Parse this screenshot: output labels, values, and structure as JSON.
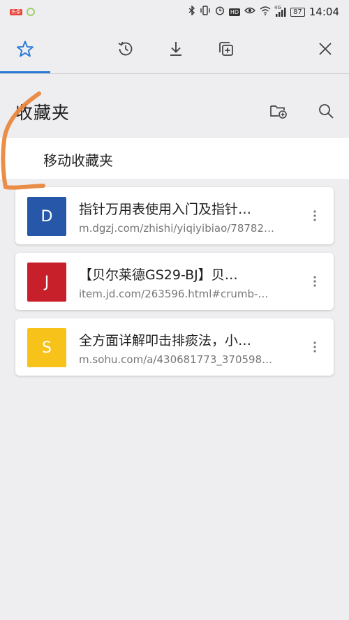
{
  "status_bar": {
    "left_badge": "头条",
    "network": "4G",
    "battery": "87",
    "time": "14:04"
  },
  "tabs": [
    {
      "name": "favorites",
      "icon": "star-icon"
    },
    {
      "name": "history",
      "icon": "history-icon"
    },
    {
      "name": "downloads",
      "icon": "download-icon"
    },
    {
      "name": "tabs",
      "icon": "tabs-icon"
    }
  ],
  "header": {
    "title": "收藏夹"
  },
  "move_row": {
    "label": "移动收藏夹"
  },
  "items": [
    {
      "letter": "D",
      "color": "#2657a8",
      "title": "指针万用表使用入门及指针…",
      "url": "m.dgzj.com/zhishi/yiqiyibiao/78782…"
    },
    {
      "letter": "J",
      "color": "#c8202b",
      "title": "【贝尔莱德GS29-BJ】贝…",
      "url": "item.jd.com/263596.html#crumb-…"
    },
    {
      "letter": "S",
      "color": "#f7c21a",
      "title": "全方面详解叩击排痰法，小…",
      "url": "m.sohu.com/a/430681773_370598…"
    }
  ],
  "colors": {
    "accent": "#2a7bd6",
    "annotation": "#e8843a"
  }
}
